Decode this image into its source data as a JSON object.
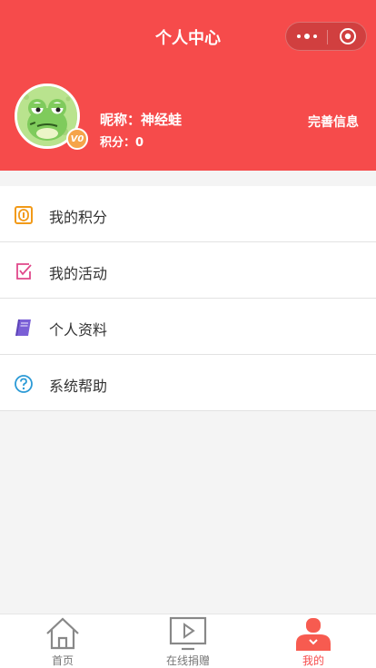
{
  "header": {
    "title": "个人中心",
    "nickname": "昵称：神经蛙",
    "points": "积分：0",
    "edit_label": "完善信息",
    "vip_badge": "V0",
    "accent_color": "#f64b4b"
  },
  "menu": {
    "items": [
      {
        "label": "我的积分",
        "icon": "points-icon"
      },
      {
        "label": "我的活动",
        "icon": "activity-check-icon"
      },
      {
        "label": "个人资料",
        "icon": "profile-book-icon"
      },
      {
        "label": "系统帮助",
        "icon": "help-question-icon"
      }
    ]
  },
  "tabbar": {
    "tabs": [
      {
        "label": "首页",
        "icon": "home-icon",
        "active": false
      },
      {
        "label": "在线捐赠",
        "icon": "donate-play-icon",
        "active": false
      },
      {
        "label": "我的",
        "icon": "user-icon",
        "active": true
      }
    ]
  }
}
